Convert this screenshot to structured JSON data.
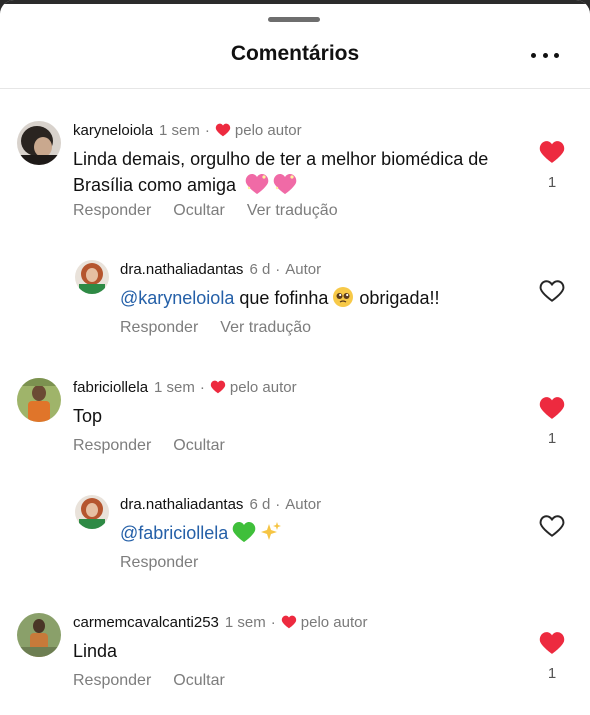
{
  "header": {
    "title": "Comentários"
  },
  "comments": [
    {
      "username": "karyneloiola",
      "time": "1 sem",
      "liked_by_author": "pelo autor",
      "text": "Linda demais, orgulho de ter a melhor biomédica de Brasília como amiga",
      "emojis": [
        "sparkling-heart",
        "sparkling-heart"
      ],
      "actions": [
        "Responder",
        "Ocultar",
        "Ver tradução"
      ],
      "like_count": "1",
      "liked": true,
      "reply": {
        "username": "dra.nathaliadantas",
        "time": "6 d",
        "role": "Autor",
        "mention": "@karyneloiola",
        "text_before_emoji": " que fofinha",
        "emoji": "pleading-face",
        "text_after_emoji": " obrigada!!",
        "actions": [
          "Responder",
          "Ver tradução"
        ],
        "liked": false
      }
    },
    {
      "username": "fabriciollela",
      "time": "1 sem",
      "liked_by_author": "pelo autor",
      "text": "Top",
      "actions": [
        "Responder",
        "Ocultar"
      ],
      "like_count": "1",
      "liked": true,
      "reply": {
        "username": "dra.nathaliadantas",
        "time": "6 d",
        "role": "Autor",
        "mention": "@fabriciollela",
        "emojis": [
          "green-heart",
          "sparkles"
        ],
        "actions": [
          "Responder"
        ],
        "liked": false
      }
    },
    {
      "username": "carmemcavalcanti253",
      "time": "1 sem",
      "liked_by_author": "pelo autor",
      "text": "Linda",
      "actions": [
        "Responder",
        "Ocultar"
      ],
      "like_count": "1",
      "liked": true
    }
  ],
  "colors": {
    "like_red": "#ed2a3f",
    "mention_blue": "#2560a8",
    "muted_grey": "#7a7a7a"
  }
}
